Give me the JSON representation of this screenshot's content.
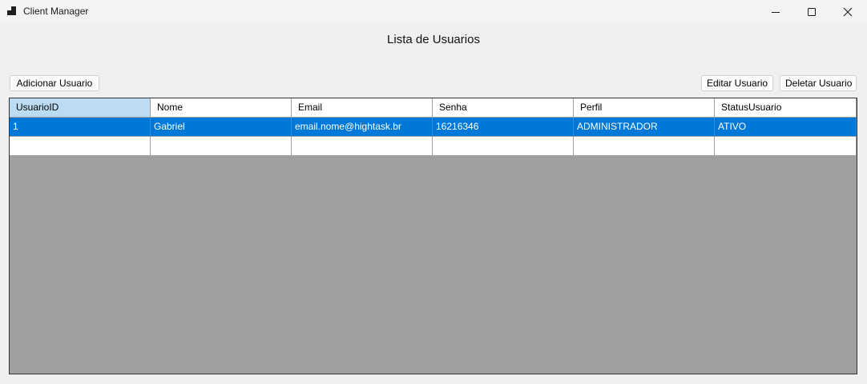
{
  "window": {
    "title": "Client Manager",
    "icon": "app-window-icon",
    "controls": [
      "minimize-icon",
      "maximize-icon",
      "close-icon"
    ]
  },
  "main": {
    "heading": "Lista de Usuarios",
    "add_button": "Adicionar Usuario",
    "edit_button": "Editar Usuario",
    "delete_button": "Deletar Usuario"
  },
  "grid": {
    "columns": [
      "UsuarioID",
      "Nome",
      "Email",
      "Senha",
      "Perfil",
      "StatusUsuario"
    ],
    "rows": [
      [
        "1",
        "Gabriel",
        "email.nome@hightask.br",
        "16216346",
        "ADMINISTRADOR",
        "ATIVO"
      ]
    ],
    "selected_row": 0,
    "colors": {
      "selection": "#0078d7",
      "header_selected": "#bcdcf4",
      "empty_area": "#a0a0a0"
    }
  }
}
